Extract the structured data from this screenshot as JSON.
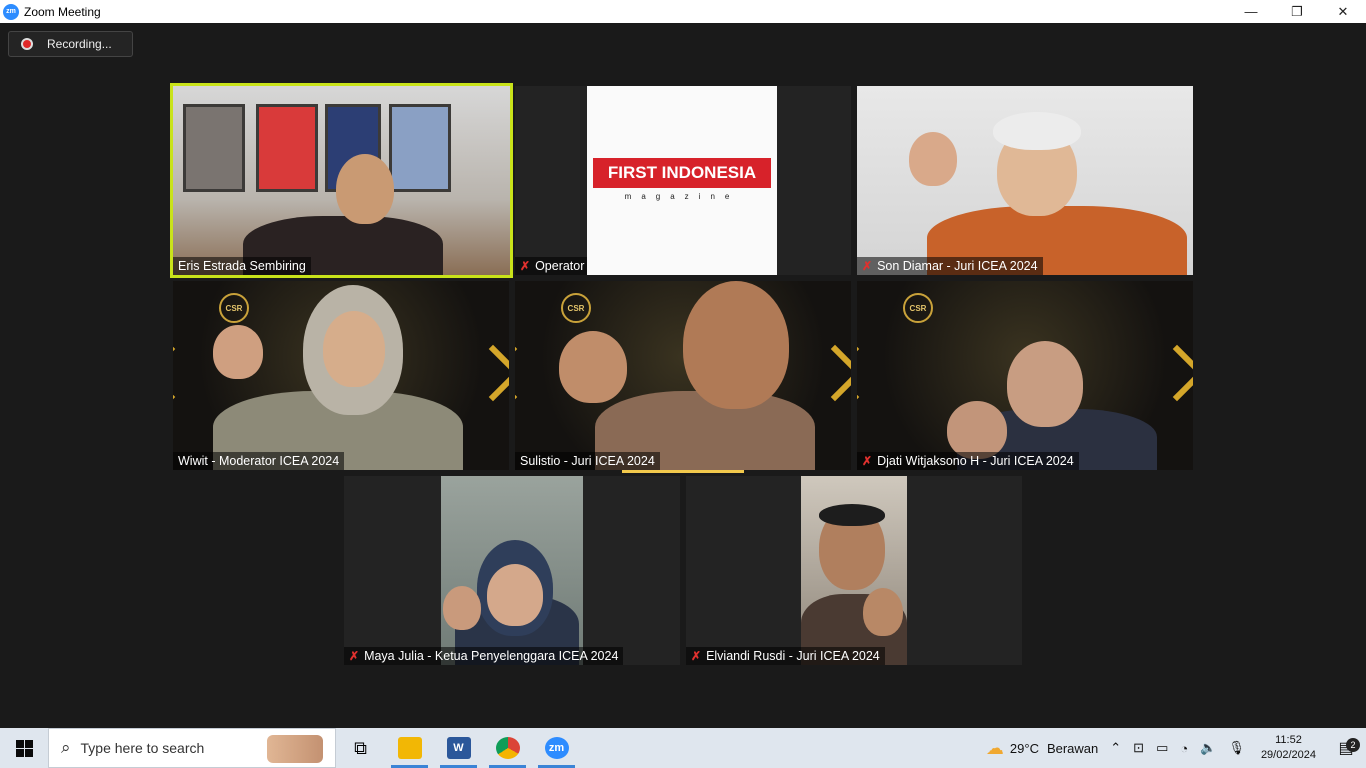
{
  "window": {
    "title": "Zoom Meeting",
    "app_icon_text": "zm",
    "controls": {
      "minimize": "—",
      "restore": "❐",
      "close": "✕"
    }
  },
  "recording": {
    "label": "Recording..."
  },
  "participants": [
    {
      "name": "Eris Estrada Sembiring",
      "muted": false,
      "active": true
    },
    {
      "name": "Operator IPM",
      "muted": true,
      "active": false
    },
    {
      "name": "Son Diamar - Juri ICEA 2024",
      "muted": true,
      "active": false
    },
    {
      "name": "Wiwit - Moderator ICEA 2024",
      "muted": false,
      "active": false
    },
    {
      "name": "Sulistio - Juri ICEA 2024",
      "muted": false,
      "active": false,
      "speaking": true
    },
    {
      "name": "Djati Witjaksono H - Juri ICEA 2024",
      "muted": true,
      "active": false
    },
    {
      "name": "Maya Julia - Ketua Penyelenggara ICEA 2024",
      "muted": true,
      "active": false
    },
    {
      "name": "Elviandi Rusdi - Juri ICEA 2024",
      "muted": true,
      "active": false
    }
  ],
  "operator_logo": {
    "title": "FIRST INDONESIA",
    "subtitle": "magazine"
  },
  "event_logo_text": "CSR",
  "taskbar": {
    "search_placeholder": "Type here to search",
    "apps": [
      "task-view",
      "file-explorer",
      "word",
      "chrome",
      "zoom"
    ],
    "word_letter": "W",
    "zoom_letter": "zm",
    "weather": {
      "temp": "29°C",
      "condition": "Berawan"
    },
    "time": "11:52",
    "date": "29/02/2024",
    "notifications": "2"
  },
  "colors": {
    "active_border": "#c9e31a",
    "mute_red": "#e0312e",
    "speaking_bar": "#f2c94c",
    "zoom_blue": "#2d8cff"
  }
}
